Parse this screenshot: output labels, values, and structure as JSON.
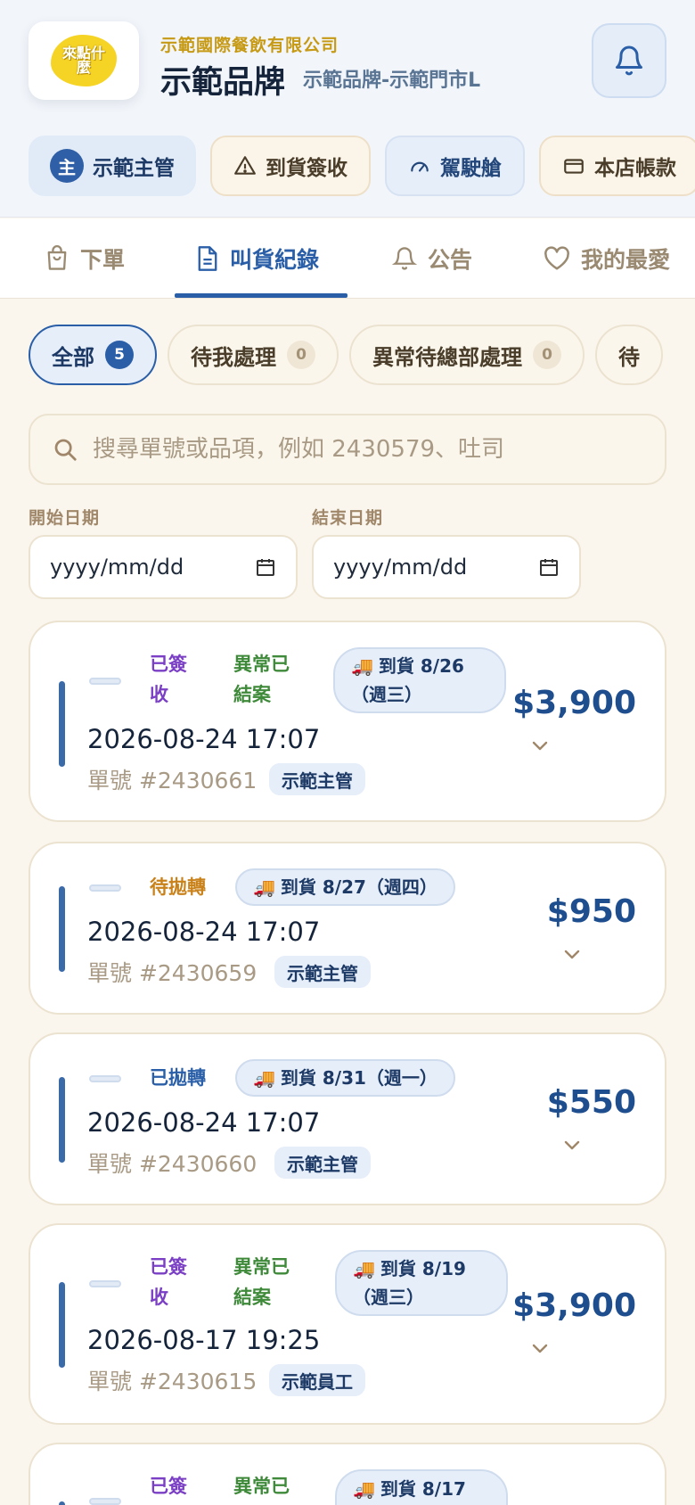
{
  "header": {
    "logo_text": "來點什麼",
    "company": "示範國際餐飲有限公司",
    "brand": "示範品牌",
    "store": "示範品牌-示範門市L"
  },
  "chips": [
    {
      "badge": "主",
      "label": "示範主管",
      "icon": "role-badge"
    },
    {
      "label": "到貨簽收",
      "icon": "warning-triangle-icon"
    },
    {
      "label": "駕駛艙",
      "icon": "gauge-icon"
    },
    {
      "label": "本店帳款",
      "icon": "card-icon"
    }
  ],
  "nav": [
    {
      "label": "下單",
      "icon": "bag-icon"
    },
    {
      "label": "叫貨紀錄",
      "icon": "document-icon",
      "active": true
    },
    {
      "label": "公告",
      "icon": "bell-icon"
    },
    {
      "label": "我的最愛",
      "icon": "heart-icon"
    }
  ],
  "filters": [
    {
      "label": "全部",
      "count": "5",
      "active": true
    },
    {
      "label": "待我處理",
      "count": "0"
    },
    {
      "label": "異常待總部處理",
      "count": "0"
    },
    {
      "label": "待",
      "count": ""
    }
  ],
  "search": {
    "placeholder": "搜尋單號或品項，例如 2430579、吐司"
  },
  "dates": {
    "start_label": "開始日期",
    "end_label": "結束日期",
    "start_value": "yyyy/mm/dd",
    "end_value": "yyyy/mm/dd"
  },
  "orders": [
    {
      "status1_a": "已簽",
      "status1_b": "收",
      "status2_a": "異常已",
      "status2_b": "結案",
      "arrival_a": "到貨 8/26",
      "arrival_b": "（週三）",
      "datetime": "2026-08-24 17:07",
      "order_no": "單號 #2430661",
      "person": "示範主管",
      "amount": "$3,900"
    },
    {
      "status1": "待拋轉",
      "arrival": "到貨 8/27（週四）",
      "datetime": "2026-08-24 17:07",
      "order_no": "單號 #2430659",
      "person": "示範主管",
      "amount": "$950"
    },
    {
      "status1": "已拋轉",
      "arrival": "到貨 8/31（週一）",
      "datetime": "2026-08-24 17:07",
      "order_no": "單號 #2430660",
      "person": "示範主管",
      "amount": "$550"
    },
    {
      "status1_a": "已簽",
      "status1_b": "收",
      "status2_a": "異常已",
      "status2_b": "結案",
      "arrival_a": "到貨 8/19",
      "arrival_b": "（週三）",
      "datetime": "2026-08-17 19:25",
      "order_no": "單號 #2430615",
      "person": "示範員工",
      "amount": "$3,900"
    },
    {
      "status1_a": "已簽",
      "status2_a": "異常已",
      "arrival_a": "到貨 8/17"
    }
  ]
}
